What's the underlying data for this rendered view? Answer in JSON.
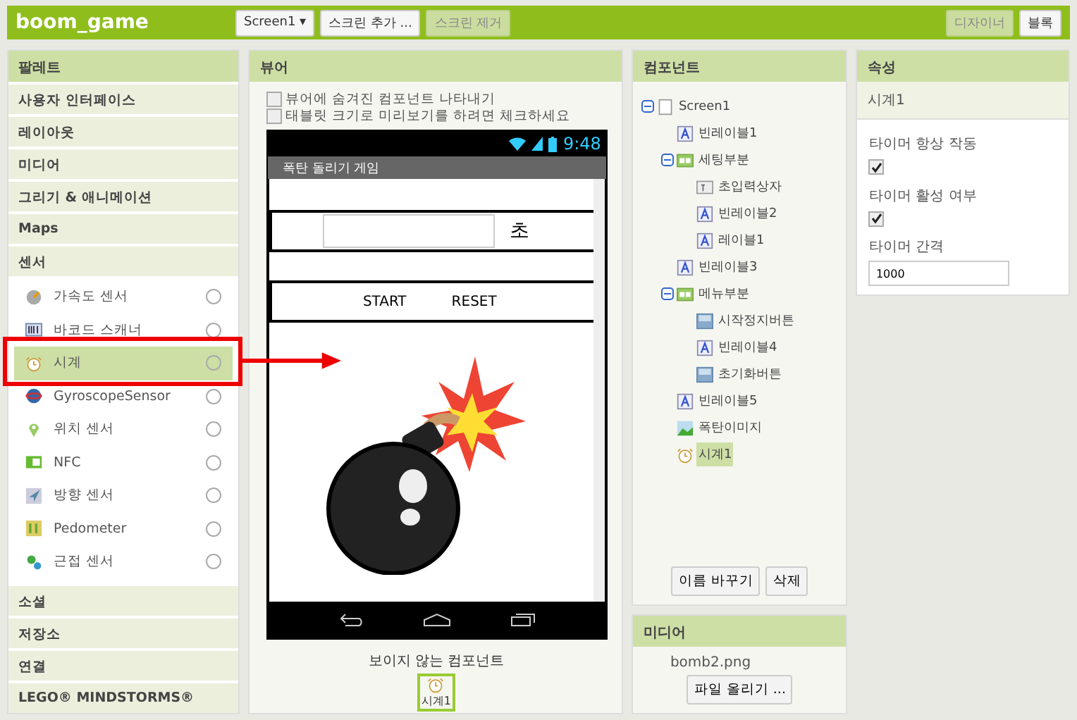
{
  "app_bar": {
    "project": "boom_game",
    "screen_dropdown": "Screen1 ▾",
    "add_screen": "스크린 추가 ...",
    "remove_screen": "스크린 제거",
    "designer": "디자이너",
    "blocks": "블록"
  },
  "palette": {
    "title": "팔레트",
    "categories": [
      {
        "label": "사용자 인터페이스"
      },
      {
        "label": "레이아웃"
      },
      {
        "label": "미디어"
      },
      {
        "label": "그리기 & 애니메이션"
      },
      {
        "label": "Maps"
      },
      {
        "label": "센서",
        "items": [
          {
            "label": "가속도 센서",
            "kind": "accelerometer",
            "selected": false
          },
          {
            "label": "바코드 스캐너",
            "kind": "barcode",
            "selected": false
          },
          {
            "label": "시계",
            "kind": "clock",
            "selected": true
          },
          {
            "label": "GyroscopeSensor",
            "kind": "gyroscope",
            "selected": false
          },
          {
            "label": "위치 센서",
            "kind": "location",
            "selected": false
          },
          {
            "label": "NFC",
            "kind": "nfc",
            "selected": false
          },
          {
            "label": "방향 센서",
            "kind": "orientation",
            "selected": false
          },
          {
            "label": "Pedometer",
            "kind": "pedometer",
            "selected": false
          },
          {
            "label": "근접 센서",
            "kind": "proximity",
            "selected": false
          }
        ]
      },
      {
        "label": "소셜"
      },
      {
        "label": "저장소"
      },
      {
        "label": "연결"
      },
      {
        "label": "LEGO® MINDSTORMS®"
      }
    ]
  },
  "viewer": {
    "title": "뷰어",
    "options": [
      {
        "label": "뷰어에 숨겨진 컴포넌트 나타내기",
        "checked": false
      },
      {
        "label": "태블릿 크기로 미리보기를 하려면 체크하세요",
        "checked": false
      }
    ],
    "phone": {
      "time": "9:48",
      "app_title": "폭탄 돌리기 게임",
      "seconds_unit": "초",
      "buttons": [
        "START",
        "RESET"
      ]
    },
    "non_visible_title": "보이지 않는 컴포넌트",
    "non_visible": [
      {
        "label": "시계1"
      }
    ]
  },
  "components": {
    "title": "컴포넌트",
    "tree": [
      {
        "label": "Screen1",
        "kind": "screen",
        "expanded": true,
        "selected": false,
        "children": [
          {
            "label": "빈레이블1",
            "kind": "label",
            "selected": false
          },
          {
            "label": "세팅부분",
            "kind": "arrangement",
            "expanded": true,
            "selected": false,
            "children": [
              {
                "label": "초입력상자",
                "kind": "textbox",
                "selected": false
              },
              {
                "label": "빈레이블2",
                "kind": "label",
                "selected": false
              },
              {
                "label": "레이블1",
                "kind": "label",
                "selected": false
              }
            ]
          },
          {
            "label": "빈레이블3",
            "kind": "label",
            "selected": false
          },
          {
            "label": "메뉴부분",
            "kind": "arrangement",
            "expanded": true,
            "selected": false,
            "children": [
              {
                "label": "시작정지버튼",
                "kind": "button",
                "selected": false
              },
              {
                "label": "빈레이블4",
                "kind": "label",
                "selected": false
              },
              {
                "label": "초기화버튼",
                "kind": "button",
                "selected": false
              }
            ]
          },
          {
            "label": "빈레이블5",
            "kind": "label",
            "selected": false
          },
          {
            "label": "폭탄이미지",
            "kind": "image",
            "selected": false
          },
          {
            "label": "시계1",
            "kind": "clock",
            "selected": true
          }
        ]
      }
    ],
    "rename": "이름 바꾸기",
    "delete": "삭제"
  },
  "media": {
    "title": "미디어",
    "files": [
      "bomb2.png"
    ],
    "upload": "파일 올리기 ..."
  },
  "properties": {
    "title": "속성",
    "component": "시계1",
    "items": [
      {
        "label": "타이머 항상 작동",
        "kind": "checkbox",
        "checked": true
      },
      {
        "label": "타이머 활성 여부",
        "kind": "checkbox",
        "checked": true
      },
      {
        "label": "타이머 간격",
        "kind": "text",
        "value": "1000"
      }
    ]
  }
}
